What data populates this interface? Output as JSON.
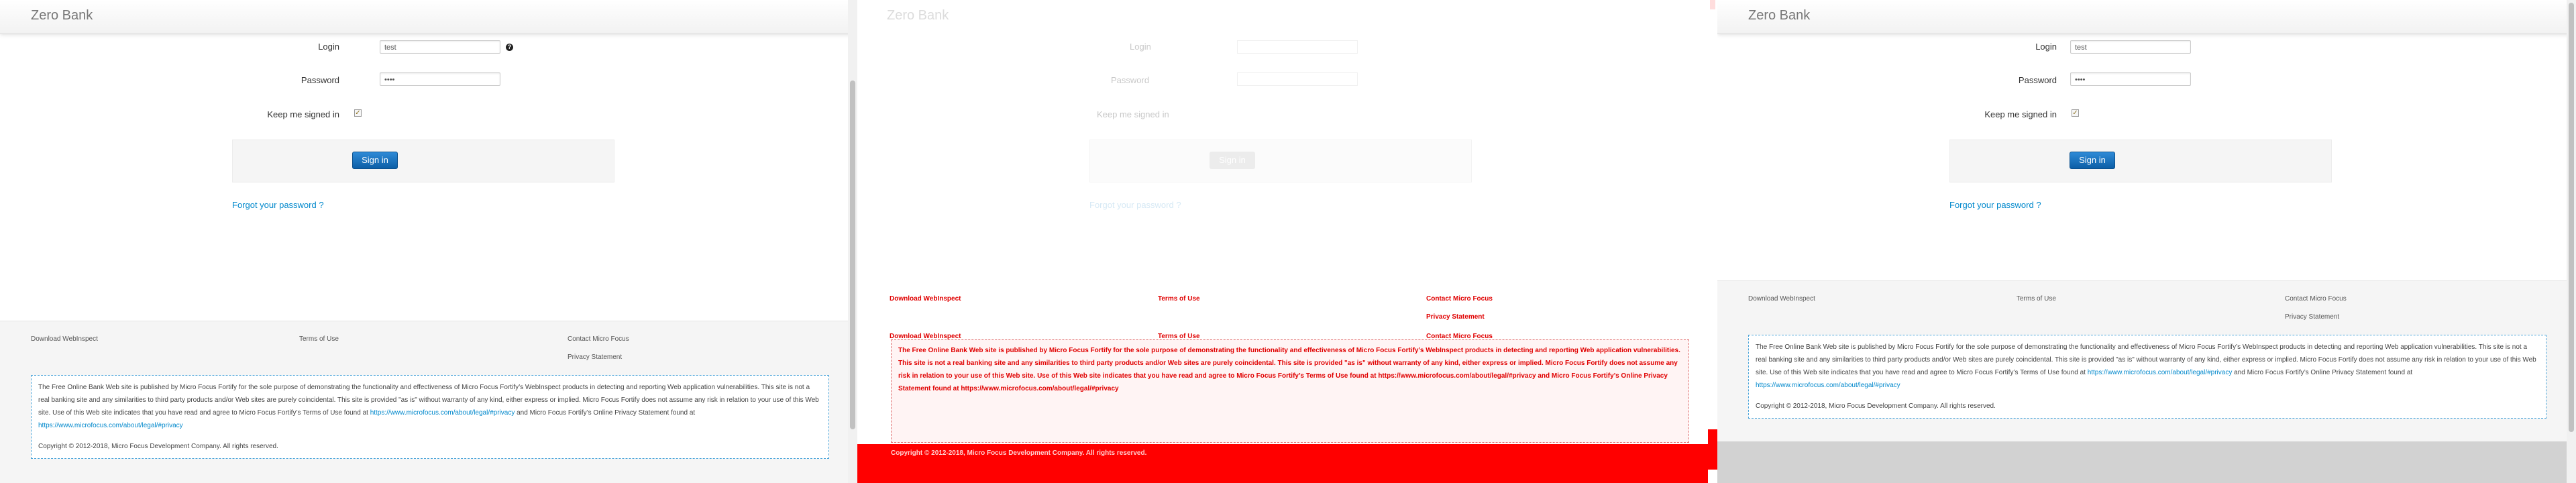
{
  "brand": "Zero Bank",
  "form": {
    "login_label": "Login",
    "login_value": "test",
    "password_label": "Password",
    "password_value": "••••",
    "keep_label": "Keep me signed in",
    "signin_label": "Sign in",
    "forgot_label": "Forgot your password ?",
    "help_glyph": "?"
  },
  "footer": {
    "download": "Download WebInspect",
    "terms": "Terms of Use",
    "contact": "Contact Micro Focus",
    "privacy": "Privacy Statement",
    "disclaimer_1": "The Free Online Bank Web site is published by Micro Focus Fortify for the sole purpose of demonstrating the functionality and effectiveness of Micro Focus Fortify’s WebInspect products in detecting and reporting Web application vulnerabilities. This site is not a real banking site and any similarities to third party products and/or Web sites are purely coincidental. This site is provided \"as is\" without warranty of any kind, either express or implied. Micro Focus Fortify does not assume any risk in relation to your use of this Web site. Use of this Web site indicates that you have read and agree to Micro Focus Fortify’s Terms of Use found at",
    "terms_url": "https://www.microfocus.com/about/legal/#privacy",
    "disclaimer_2": "and Micro Focus Fortify’s Online Privacy Statement found at",
    "privacy_url": "https://www.microfocus.com/about/legal/#privacy",
    "copyright": "Copyright © 2012-2018, Micro Focus Development Company. All rights reserved."
  },
  "colors": {
    "accent": "#0088cc",
    "button": "#0c5ea6",
    "overlay_red": "#ff0000"
  }
}
